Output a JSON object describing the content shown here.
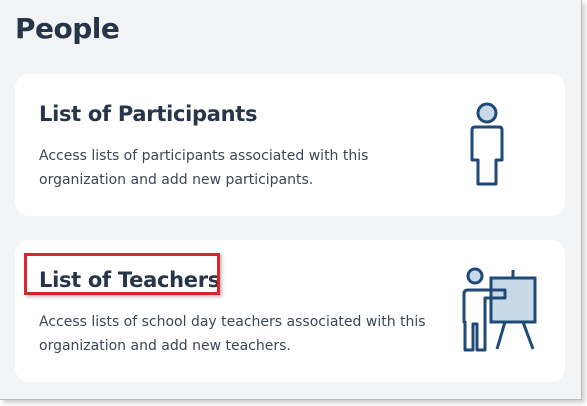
{
  "page": {
    "title": "People"
  },
  "cards": [
    {
      "title": "List of Participants",
      "description": "Access lists of participants associated with this organization and add new participants.",
      "icon": "person-icon"
    },
    {
      "title": "List of Teachers",
      "description": "Access lists of school day teachers associated with this organization and add new teachers.",
      "icon": "teacher-presenting-icon"
    }
  ],
  "colors": {
    "title_text": "#263548",
    "body_text": "#3b4656",
    "icon_stroke": "#1f4a78",
    "icon_fill": "#c9d9e8",
    "highlight": "#d9262c",
    "panel_bg": "#f3f4f6",
    "card_bg": "#ffffff"
  }
}
